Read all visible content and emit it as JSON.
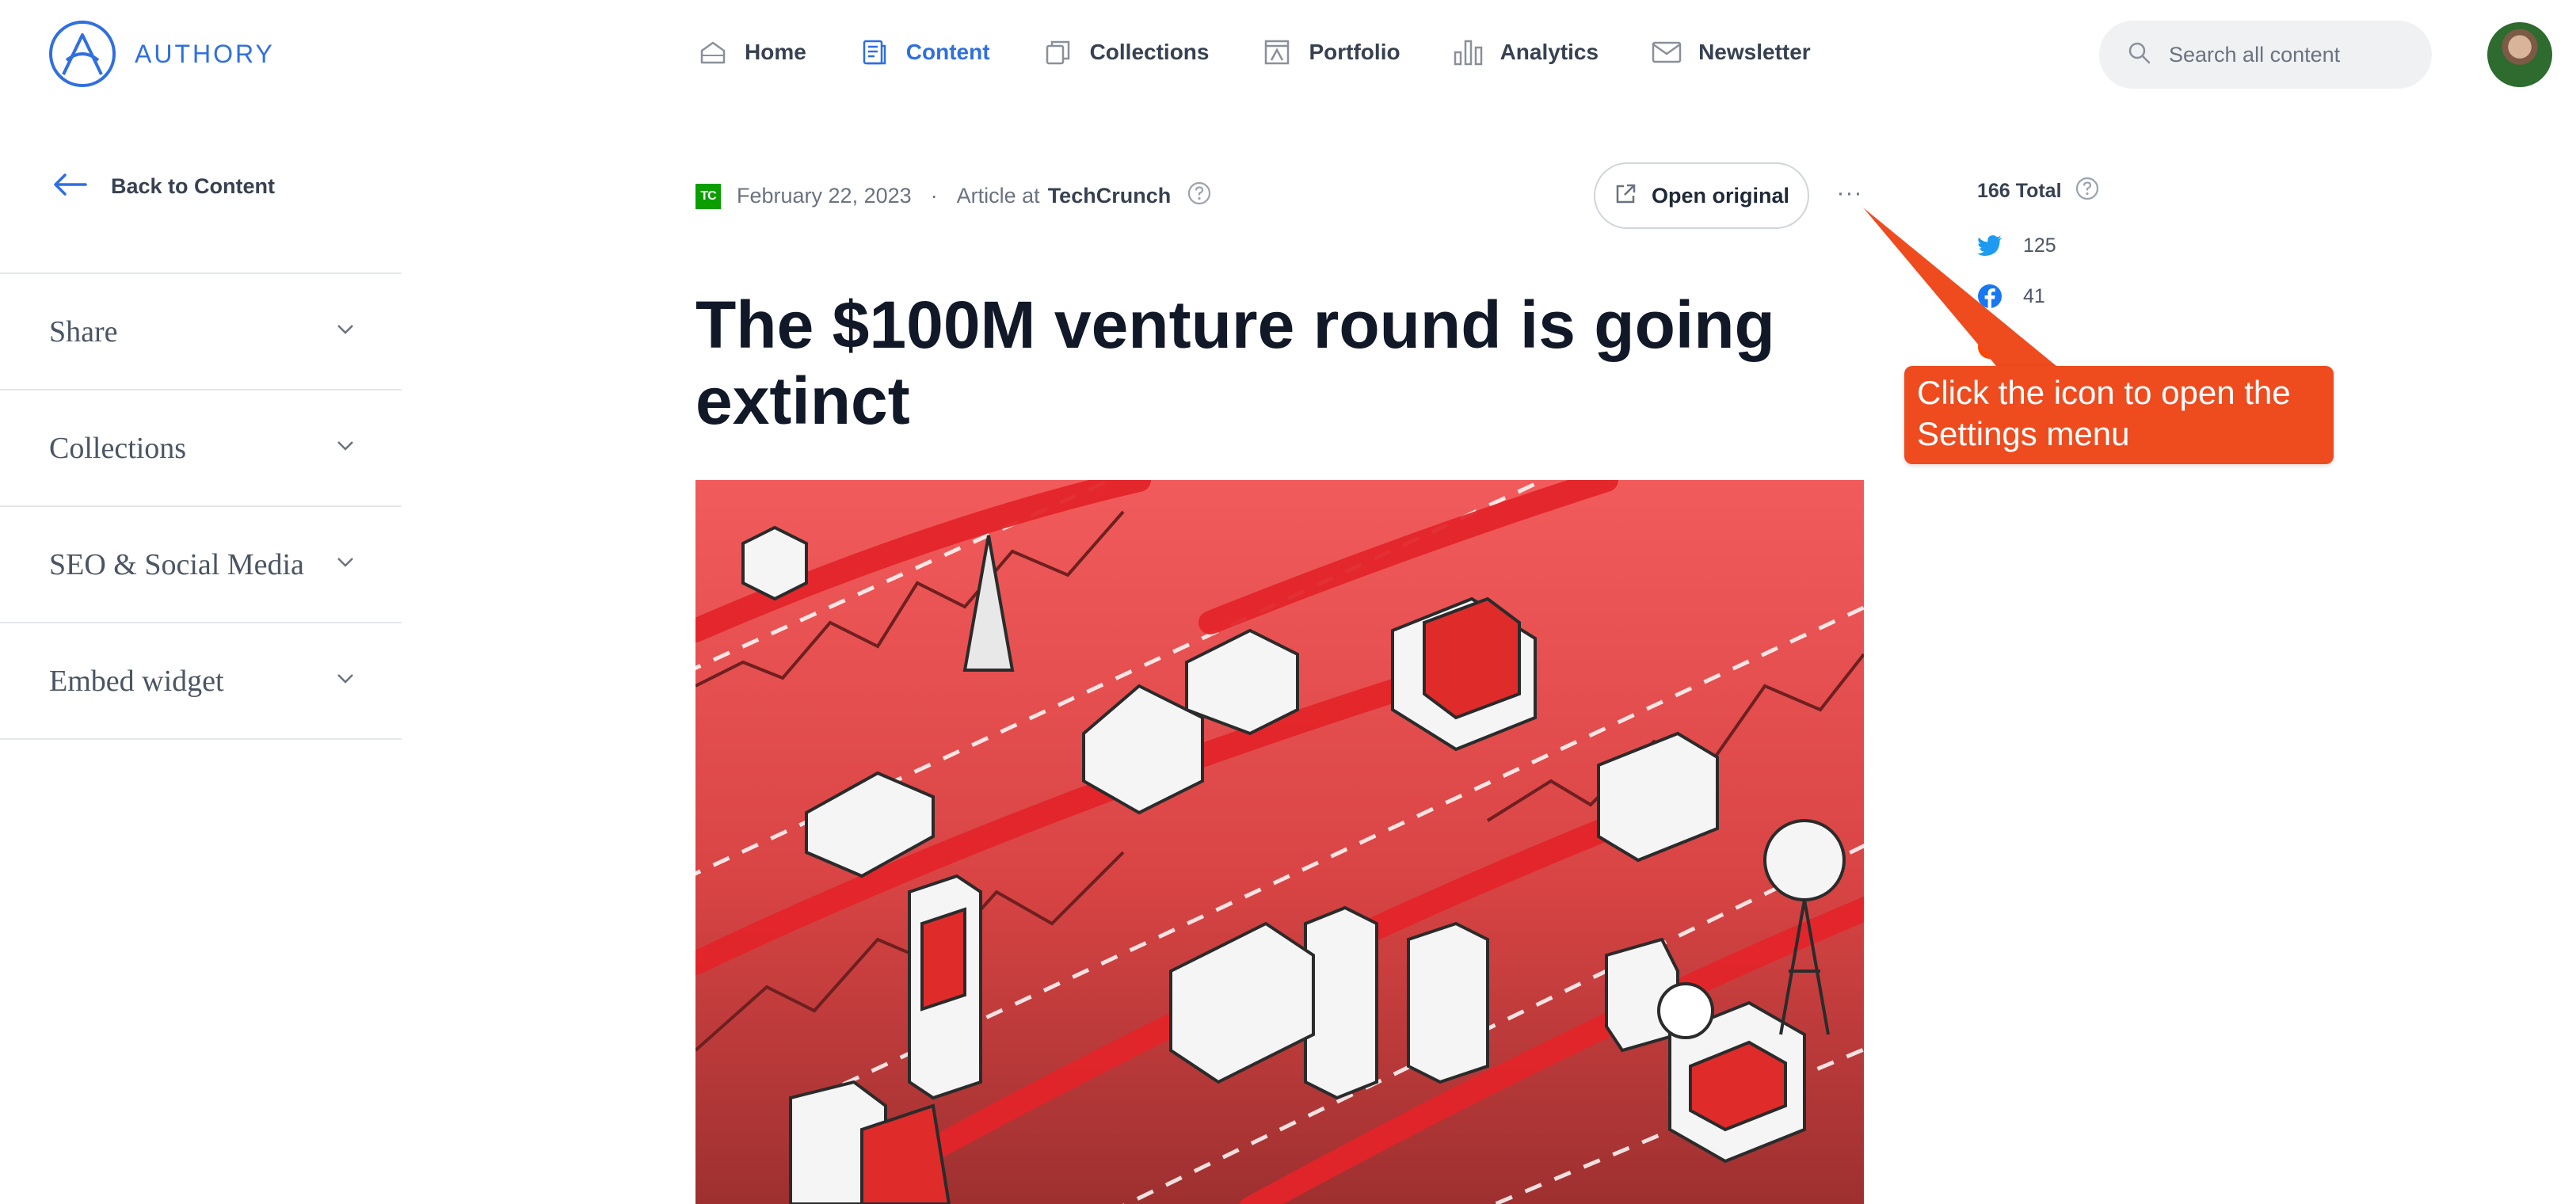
{
  "brand": {
    "name": "AUTHORY"
  },
  "nav": {
    "items": [
      {
        "label": "Home",
        "icon": "home-icon",
        "active": false
      },
      {
        "label": "Content",
        "icon": "content-icon",
        "active": true
      },
      {
        "label": "Collections",
        "icon": "collections-icon",
        "active": false
      },
      {
        "label": "Portfolio",
        "icon": "portfolio-icon",
        "active": false
      },
      {
        "label": "Analytics",
        "icon": "analytics-icon",
        "active": false
      },
      {
        "label": "Newsletter",
        "icon": "newsletter-icon",
        "active": false
      }
    ]
  },
  "search": {
    "placeholder": "Search all content",
    "value": ""
  },
  "sidebar": {
    "back_label": "Back to Content",
    "sections": [
      {
        "label": "Share"
      },
      {
        "label": "Collections"
      },
      {
        "label": "SEO & Social Media"
      },
      {
        "label": "Embed widget"
      }
    ]
  },
  "article": {
    "source_badge": "TC",
    "date": "February 22, 2023",
    "separator": "·",
    "type_prefix": "Article at",
    "source": "TechCrunch",
    "title": "The $100M venture round is going extinct",
    "open_original_label": "Open original",
    "more_label": "···"
  },
  "stats": {
    "total_label": "166 Total",
    "twitter": "125",
    "facebook": "41",
    "other": "-"
  },
  "callout": {
    "text": "Click the icon to open the Settings menu"
  },
  "colors": {
    "accent": "#2f6fe0",
    "callout": "#ee4b1f",
    "hero_red": "#ef5350",
    "techcrunch_green": "#0a9e01",
    "twitter_blue": "#1d9bf0",
    "facebook_blue": "#1877f2"
  }
}
